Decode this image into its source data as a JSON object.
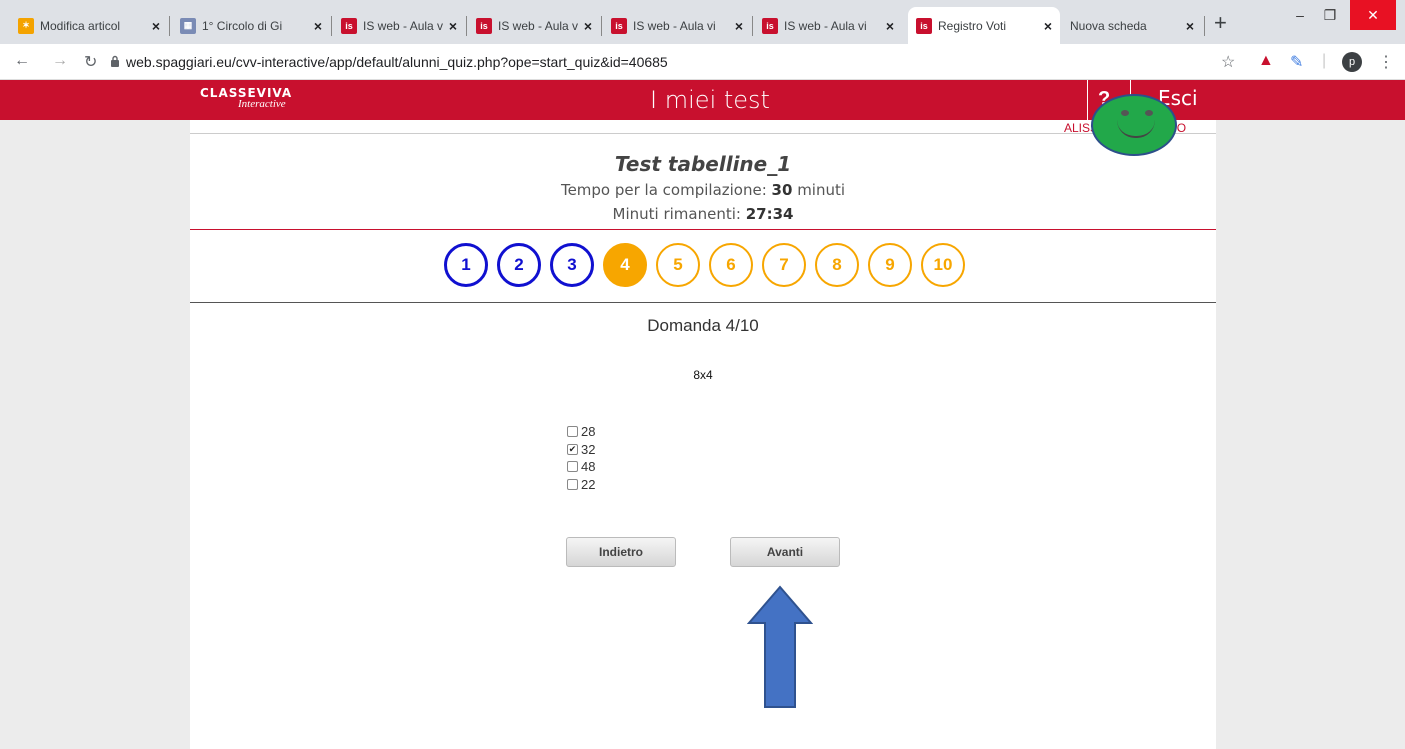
{
  "browser": {
    "tabs": [
      {
        "title": "Modifica articol",
        "favicon": "joomla-icon",
        "color": "#f4a300",
        "active": false
      },
      {
        "title": "1° Circolo di Gi",
        "favicon": "school-icon",
        "color": "#7a8bb5",
        "active": false
      },
      {
        "title": "IS web - Aula vi",
        "favicon": "is-icon",
        "color": "#c8102e",
        "active": false
      },
      {
        "title": "IS web - Aula vi",
        "favicon": "is-icon",
        "color": "#c8102e",
        "active": false
      },
      {
        "title": "IS web - Aula vi",
        "favicon": "is-icon",
        "color": "#c8102e",
        "active": false
      },
      {
        "title": "IS web - Aula vi",
        "favicon": "is-icon",
        "color": "#c8102e",
        "active": false
      },
      {
        "title": "Registro Voti",
        "favicon": "is-icon",
        "color": "#c8102e",
        "active": true
      },
      {
        "title": "Nuova scheda",
        "favicon": "",
        "color": "",
        "active": false
      }
    ],
    "favicon_label": "is",
    "url": "web.spaggiari.eu/cvv-interactive/app/default/alunni_quiz.php?ope=start_quiz&id=40685",
    "profile_initial": "p"
  },
  "header": {
    "logo_main": "CLASSEVIVA",
    "logo_sub": "Interactive",
    "title": "I miei test",
    "help": "?",
    "logout": "Esci",
    "username": "ALISSANDRA LONGO",
    "color": "#c8102e"
  },
  "test": {
    "title": "Test tabelline_1",
    "time_label": "Tempo per la compilazione: ",
    "time_value": "30",
    "time_unit": " minuti",
    "remaining_label": "Minuti rimanenti: ",
    "remaining_value": "27:34"
  },
  "nav": {
    "questions": [
      {
        "label": "1",
        "state": "done"
      },
      {
        "label": "2",
        "state": "done"
      },
      {
        "label": "3",
        "state": "done"
      },
      {
        "label": "4",
        "state": "current"
      },
      {
        "label": "5",
        "state": "todo"
      },
      {
        "label": "6",
        "state": "todo"
      },
      {
        "label": "7",
        "state": "todo"
      },
      {
        "label": "8",
        "state": "todo"
      },
      {
        "label": "9",
        "state": "todo"
      },
      {
        "label": "10",
        "state": "todo"
      }
    ],
    "colors": {
      "done": "#1010d0",
      "current": "#f7a600",
      "todo": "#f7a600"
    }
  },
  "question": {
    "header": "Domanda 4/10",
    "text": "8x4",
    "answers": [
      {
        "label": "28",
        "checked": false
      },
      {
        "label": "32",
        "checked": true
      },
      {
        "label": "48",
        "checked": false
      },
      {
        "label": "22",
        "checked": false
      }
    ]
  },
  "buttons": {
    "back": "Indietro",
    "next": "Avanti"
  },
  "annotations": {
    "smiley_color": "#22a84a",
    "arrow_color": "#4472c4"
  }
}
